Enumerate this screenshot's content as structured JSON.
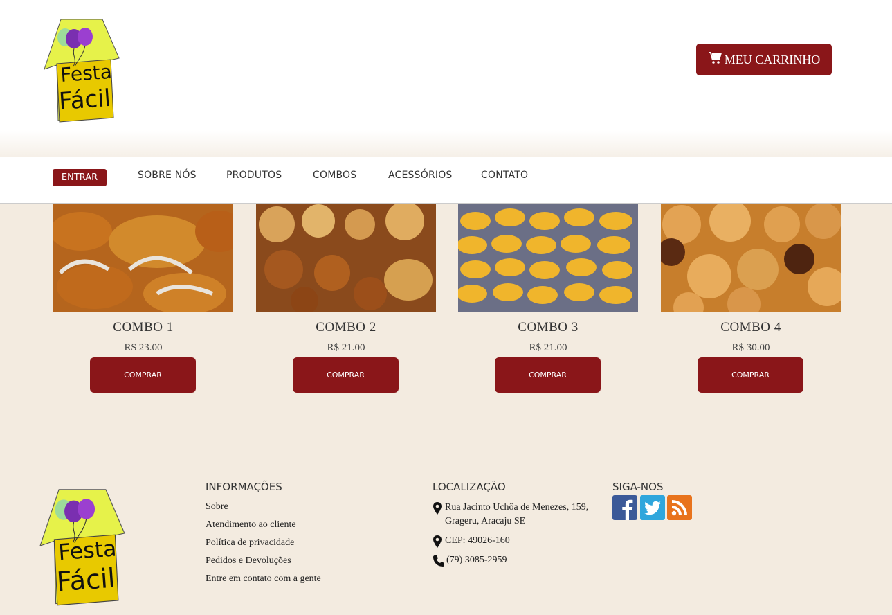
{
  "brand": {
    "line1": "Festa",
    "line2": "Fácil"
  },
  "header": {
    "cart_label": "MEU CARRINHO",
    "cart_icon": "cart-icon"
  },
  "nav": {
    "login_label": "ENTRAR",
    "items": [
      "SOBRE NÓS",
      "PRODUTOS",
      "COMBOS",
      "ACESSÓRIOS",
      "CONTATO"
    ]
  },
  "products": [
    {
      "title": "COMBO 1",
      "price": "R$ 23.00",
      "button": "COMPRAR"
    },
    {
      "title": "COMBO 2",
      "price": "R$ 21.00",
      "button": "COMPRAR"
    },
    {
      "title": "COMBO 3",
      "price": "R$ 21.00",
      "button": "COMPRAR"
    },
    {
      "title": "COMBO 4",
      "price": "R$ 30.00",
      "button": "COMPRAR"
    }
  ],
  "footer": {
    "info": {
      "heading": "INFORMAÇÕES",
      "links": [
        "Sobre",
        "Atendimento ao cliente",
        "Política de privacidade",
        "Pedidos e Devoluções",
        "Entre em contato com a gente"
      ]
    },
    "location": {
      "heading": "LOCALIZAÇÃO",
      "address_line1": "Rua Jacinto Uchôa de Menezes, 159,",
      "address_line2": "Grageru, Aracaju SE",
      "cep": "CEP: 49026-160",
      "phone": "(79) 3085-2959"
    },
    "social": {
      "heading": "SIGA-NOS",
      "icons": [
        "facebook-icon",
        "twitter-icon",
        "rss-icon"
      ]
    }
  },
  "colors": {
    "accent": "#8a1619",
    "background": "#f3ebe0",
    "logo_yellow": "#e8c900",
    "logo_lime": "#e6f24a"
  }
}
